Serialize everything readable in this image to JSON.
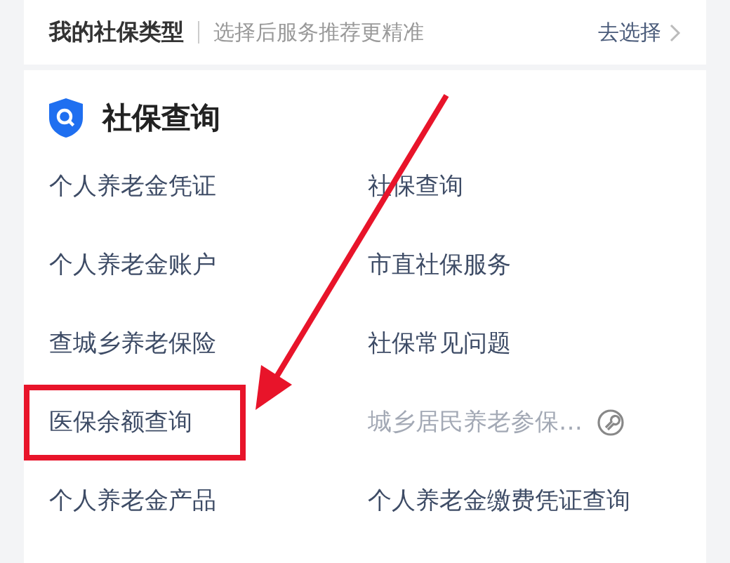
{
  "social_security_type": {
    "label": "我的社保类型",
    "hint": "选择后服务推荐更精准",
    "action": "去选择"
  },
  "section": {
    "title": "社保查询",
    "items": [
      {
        "label": "个人养老金凭证",
        "disabled": false,
        "highlighted": false
      },
      {
        "label": "社保查询",
        "disabled": false,
        "highlighted": false
      },
      {
        "label": "个人养老金账户",
        "disabled": false,
        "highlighted": false
      },
      {
        "label": "市直社保服务",
        "disabled": false,
        "highlighted": false
      },
      {
        "label": "查城乡养老保险",
        "disabled": false,
        "highlighted": false
      },
      {
        "label": "社保常见问题",
        "disabled": false,
        "highlighted": false
      },
      {
        "label": "医保余额查询",
        "disabled": false,
        "highlighted": true
      },
      {
        "label": "城乡居民养老参保…",
        "disabled": true,
        "highlighted": false
      },
      {
        "label": "个人养老金产品",
        "disabled": false,
        "highlighted": false
      },
      {
        "label": "个人养老金缴费凭证查询",
        "disabled": false,
        "highlighted": false
      }
    ]
  }
}
